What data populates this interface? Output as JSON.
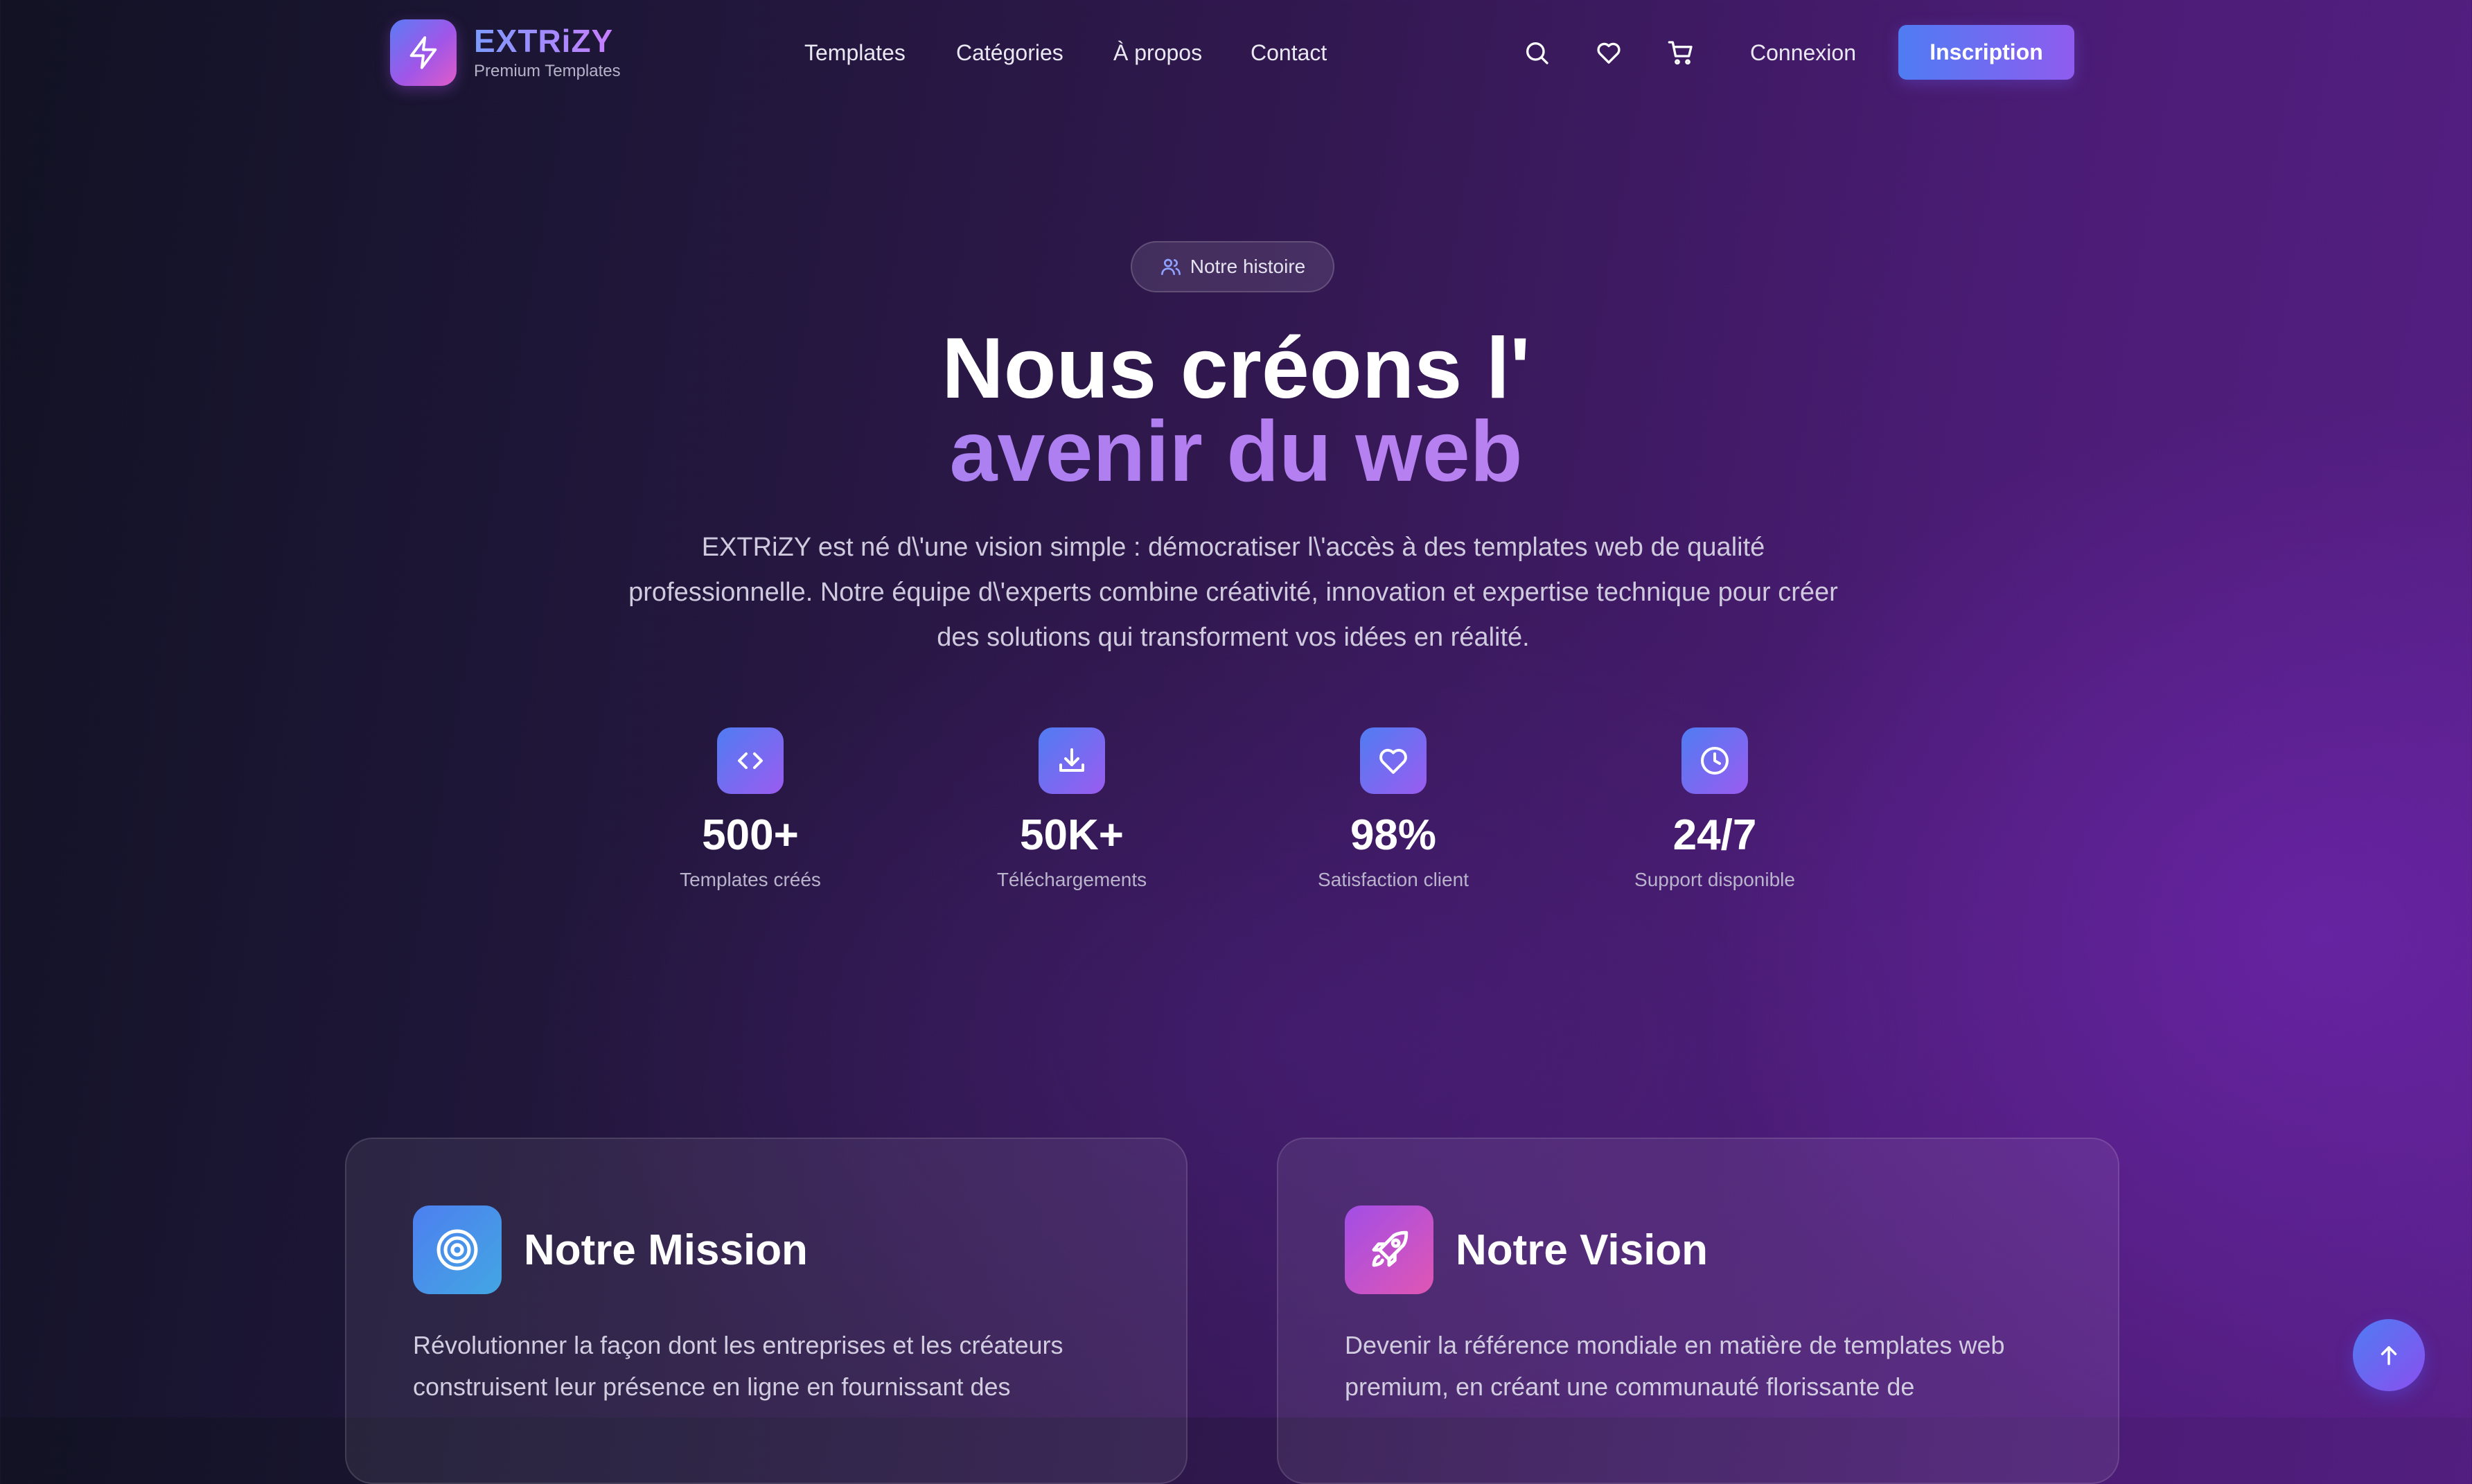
{
  "brand": {
    "name": "EXTRiZY",
    "tagline": "Premium Templates",
    "logo_icon": "lightning-bolt-icon"
  },
  "nav": {
    "links": [
      "Templates",
      "Catégories",
      "À propos",
      "Contact"
    ],
    "icons": [
      "search-icon",
      "heart-icon",
      "cart-icon"
    ],
    "login_label": "Connexion",
    "signup_label": "Inscription"
  },
  "hero": {
    "badge_label": "Notre histoire",
    "badge_icon": "users-icon",
    "title_line1": "Nous créons l'",
    "title_line2": "avenir du web",
    "description": "EXTRiZY est né d\\'une vision simple : démocratiser l\\'accès à des templates web de qualité professionnelle. Notre équipe d\\'experts combine créativité, innovation et expertise technique pour créer des solutions qui transforment vos idées en réalité."
  },
  "stats": [
    {
      "icon": "code-icon",
      "value": "500+",
      "label": "Templates créés"
    },
    {
      "icon": "download-icon",
      "value": "50K+",
      "label": "Téléchargements"
    },
    {
      "icon": "heart-icon",
      "value": "98%",
      "label": "Satisfaction client"
    },
    {
      "icon": "clock-icon",
      "value": "24/7",
      "label": "Support disponible"
    }
  ],
  "cards": [
    {
      "icon": "target-icon",
      "title": "Notre Mission",
      "text": "Révolutionner la façon dont les entreprises et les créateurs construisent leur présence en ligne en fournissant des"
    },
    {
      "icon": "rocket-icon",
      "title": "Notre Vision",
      "text": "Devenir la référence mondiale en matière de templates web premium, en créant une communauté florissante de"
    }
  ],
  "colors": {
    "accent_blue": "#4f7cf2",
    "accent_purple": "#9b5cf0",
    "accent_pink": "#e05bc8",
    "background_dark": "#111223",
    "background_purple": "#561f85"
  },
  "scroll_top_icon": "arrow-up-icon"
}
